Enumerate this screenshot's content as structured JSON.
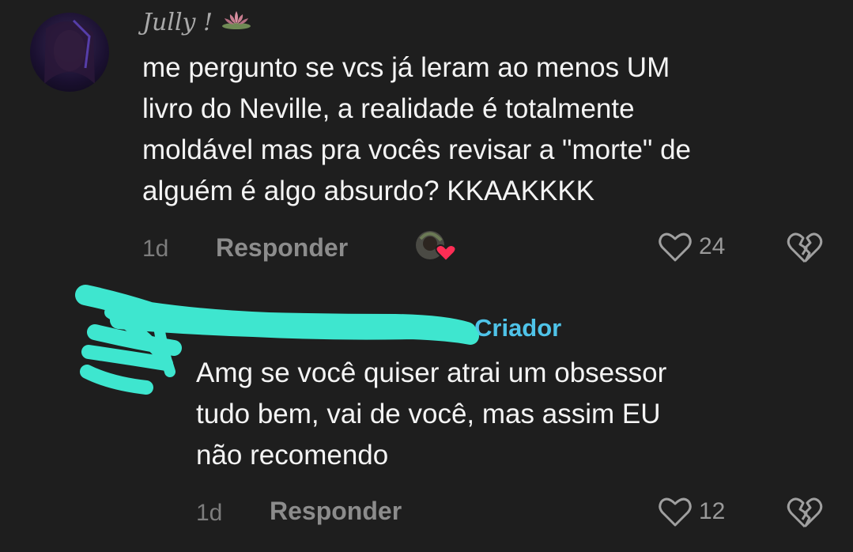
{
  "comment1": {
    "username": "Jully !",
    "username_emoji": "lotus-emoji",
    "text_lines": [
      "me pergunto se vcs já leram ao menos UM",
      "livro do Neville, a realidade é totalmente",
      "moldável mas pra vocês revisar a \"morte\" de",
      "alguém é algo absurdo? KKAAKKKK"
    ],
    "time": "1d",
    "reply_label": "Responder",
    "like_count": "24"
  },
  "comment2": {
    "creator_label": "Criador",
    "text_lines": [
      "Amg se você quiser atrai um obsessor",
      "tudo bem, vai de você, mas assim EU",
      "não recomendo"
    ],
    "time": "1d",
    "reply_label": "Responder",
    "like_count": "12"
  },
  "colors": {
    "background": "#1e1e1e",
    "creator_accent": "#4fc3e8",
    "scribble": "#3ee6cf",
    "heart_red": "#ff2d55"
  }
}
